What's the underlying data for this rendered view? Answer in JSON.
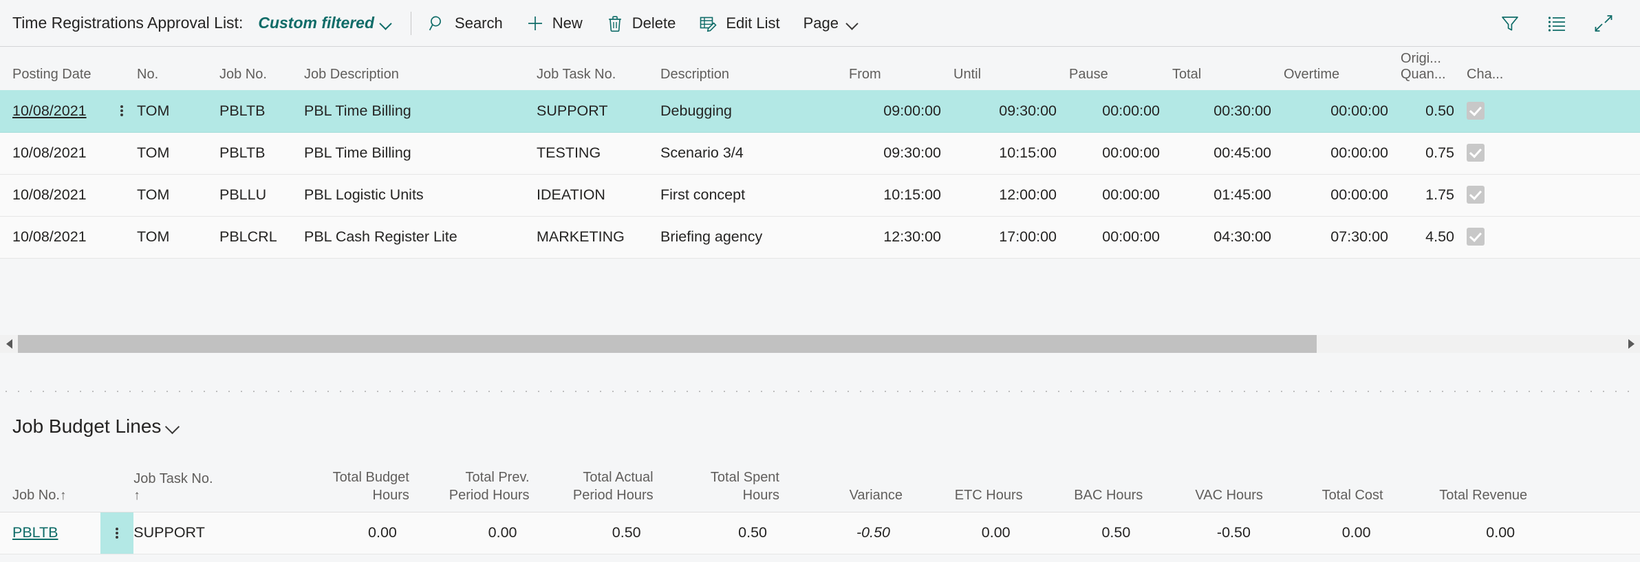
{
  "command_bar": {
    "page_title": "Time Registrations Approval List:",
    "filter_view": {
      "label": "Custom filtered",
      "chevron_icon": "chevron-down-icon"
    },
    "actions": [
      {
        "id": "search",
        "label": "Search",
        "icon": "search-icon"
      },
      {
        "id": "new",
        "label": "New",
        "icon": "plus-icon"
      },
      {
        "id": "delete",
        "label": "Delete",
        "icon": "trash-icon"
      },
      {
        "id": "edit-list",
        "label": "Edit List",
        "icon": "edit-list-icon"
      },
      {
        "id": "page",
        "label": "Page",
        "icon": "chevron-down-icon"
      }
    ],
    "right_icons": [
      {
        "id": "filter",
        "icon": "funnel-filter-icon"
      },
      {
        "id": "list-view",
        "icon": "list-view-icon"
      },
      {
        "id": "collapse",
        "icon": "collapse-arrows-icon"
      }
    ]
  },
  "time_registrations": {
    "columns": [
      "Posting Date",
      "No.",
      "Job No.",
      "Job Description",
      "Job Task No.",
      "Description",
      "From",
      "Until",
      "Pause",
      "Total",
      "Overtime",
      "Origi... Quan...",
      "Cha..."
    ],
    "column_header_multiline": {
      "quantity_line1": "Origi...",
      "quantity_line2": "Quan...",
      "chargeable": "Cha..."
    },
    "rows": [
      {
        "selected": true,
        "posting_date": "10/08/2021",
        "no": "TOM",
        "job_no": "PBLTB",
        "job_description": "PBL Time Billing",
        "job_task_no": "SUPPORT",
        "description": "Debugging",
        "from": "09:00:00",
        "until": "09:30:00",
        "pause": "00:00:00",
        "total": "00:30:00",
        "overtime": "00:00:00",
        "original_quantity": "0.50",
        "chargeable": true
      },
      {
        "selected": false,
        "posting_date": "10/08/2021",
        "no": "TOM",
        "job_no": "PBLTB",
        "job_description": "PBL Time Billing",
        "job_task_no": "TESTING",
        "description": "Scenario 3/4",
        "from": "09:30:00",
        "until": "10:15:00",
        "pause": "00:00:00",
        "total": "00:45:00",
        "overtime": "00:00:00",
        "original_quantity": "0.75",
        "chargeable": true
      },
      {
        "selected": false,
        "posting_date": "10/08/2021",
        "no": "TOM",
        "job_no": "PBLLU",
        "job_description": "PBL Logistic Units",
        "job_task_no": "IDEATION",
        "description": "First concept",
        "from": "10:15:00",
        "until": "12:00:00",
        "pause": "00:00:00",
        "total": "01:45:00",
        "overtime": "00:00:00",
        "original_quantity": "1.75",
        "chargeable": true
      },
      {
        "selected": false,
        "posting_date": "10/08/2021",
        "no": "TOM",
        "job_no": "PBLCRL",
        "job_description": "PBL Cash Register Lite",
        "job_task_no": "MARKETING",
        "description": "Briefing agency",
        "from": "12:30:00",
        "until": "17:00:00",
        "pause": "00:00:00",
        "total": "04:30:00",
        "overtime": "07:30:00",
        "original_quantity": "4.50",
        "chargeable": true
      }
    ]
  },
  "job_budget_lines": {
    "title": "Job Budget Lines",
    "chevron_icon": "chevron-down-icon",
    "columns": {
      "job_no": {
        "label": "Job No.",
        "sort": "↑"
      },
      "job_task_no": {
        "line1": "Job Task No.",
        "line2": "↑"
      },
      "total_budget_hours": {
        "line1": "Total Budget",
        "line2": "Hours"
      },
      "total_prev_period_hours": {
        "line1": "Total Prev.",
        "line2": "Period Hours"
      },
      "total_actual_period_hours": {
        "line1": "Total Actual",
        "line2": "Period Hours"
      },
      "total_spent_hours": {
        "line1": "Total Spent",
        "line2": "Hours"
      },
      "variance": {
        "label": "Variance"
      },
      "etc_hours": {
        "label": "ETC Hours"
      },
      "bac_hours": {
        "label": "BAC Hours"
      },
      "vac_hours": {
        "label": "VAC Hours"
      },
      "total_cost": {
        "label": "Total Cost"
      },
      "total_revenue": {
        "label": "Total Revenue"
      }
    },
    "rows": [
      {
        "job_no": "PBLTB",
        "job_task_no": "SUPPORT",
        "total_budget_hours": "0.00",
        "total_prev_period_hours": "0.00",
        "total_actual_period_hours": "0.50",
        "total_spent_hours": "0.50",
        "variance": "-0.50",
        "variance_negative": true,
        "etc_hours": "0.00",
        "bac_hours": "0.50",
        "vac_hours": "-0.50",
        "total_cost": "0.00",
        "total_revenue": "0.00"
      }
    ]
  },
  "scrollbar": {
    "left_arrow_icon": "triangle-left-icon",
    "right_arrow_icon": "triangle-right-icon"
  },
  "colors": {
    "accent_teal": "#0f6c68",
    "selection": "#b3e8e5",
    "negative": "#c0392b",
    "page_bg": "#f5f6f7"
  }
}
